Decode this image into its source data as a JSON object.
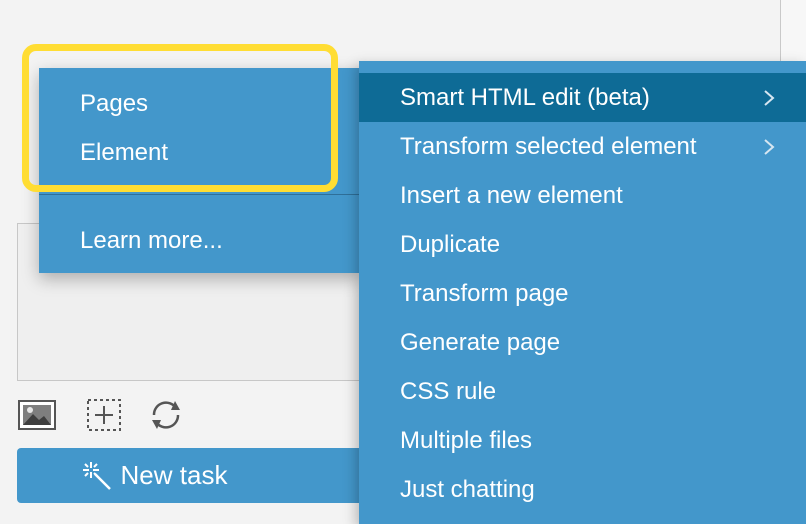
{
  "context_menu": {
    "items": [
      {
        "label": "Pages"
      },
      {
        "label": "Element"
      },
      {
        "label": "Learn more..."
      }
    ]
  },
  "submenu": {
    "items": [
      {
        "label": "Smart HTML edit (beta)",
        "has_submenu": true,
        "active": true
      },
      {
        "label": "Transform selected element",
        "has_submenu": true
      },
      {
        "label": "Insert a new element"
      },
      {
        "label": "Duplicate"
      },
      {
        "label": "Transform page"
      },
      {
        "label": "Generate page"
      },
      {
        "label": "CSS rule"
      },
      {
        "label": "Multiple files"
      },
      {
        "label": "Just chatting"
      }
    ]
  },
  "toolbar": {
    "icons": [
      "image-icon",
      "add-element-icon",
      "refresh-icon"
    ]
  },
  "new_task_button": {
    "label": "New task",
    "icon": "magic-wand-icon"
  },
  "colors": {
    "menu_bg": "#4397cb",
    "menu_active": "#0e6b96",
    "highlight": "#ffdd33"
  }
}
